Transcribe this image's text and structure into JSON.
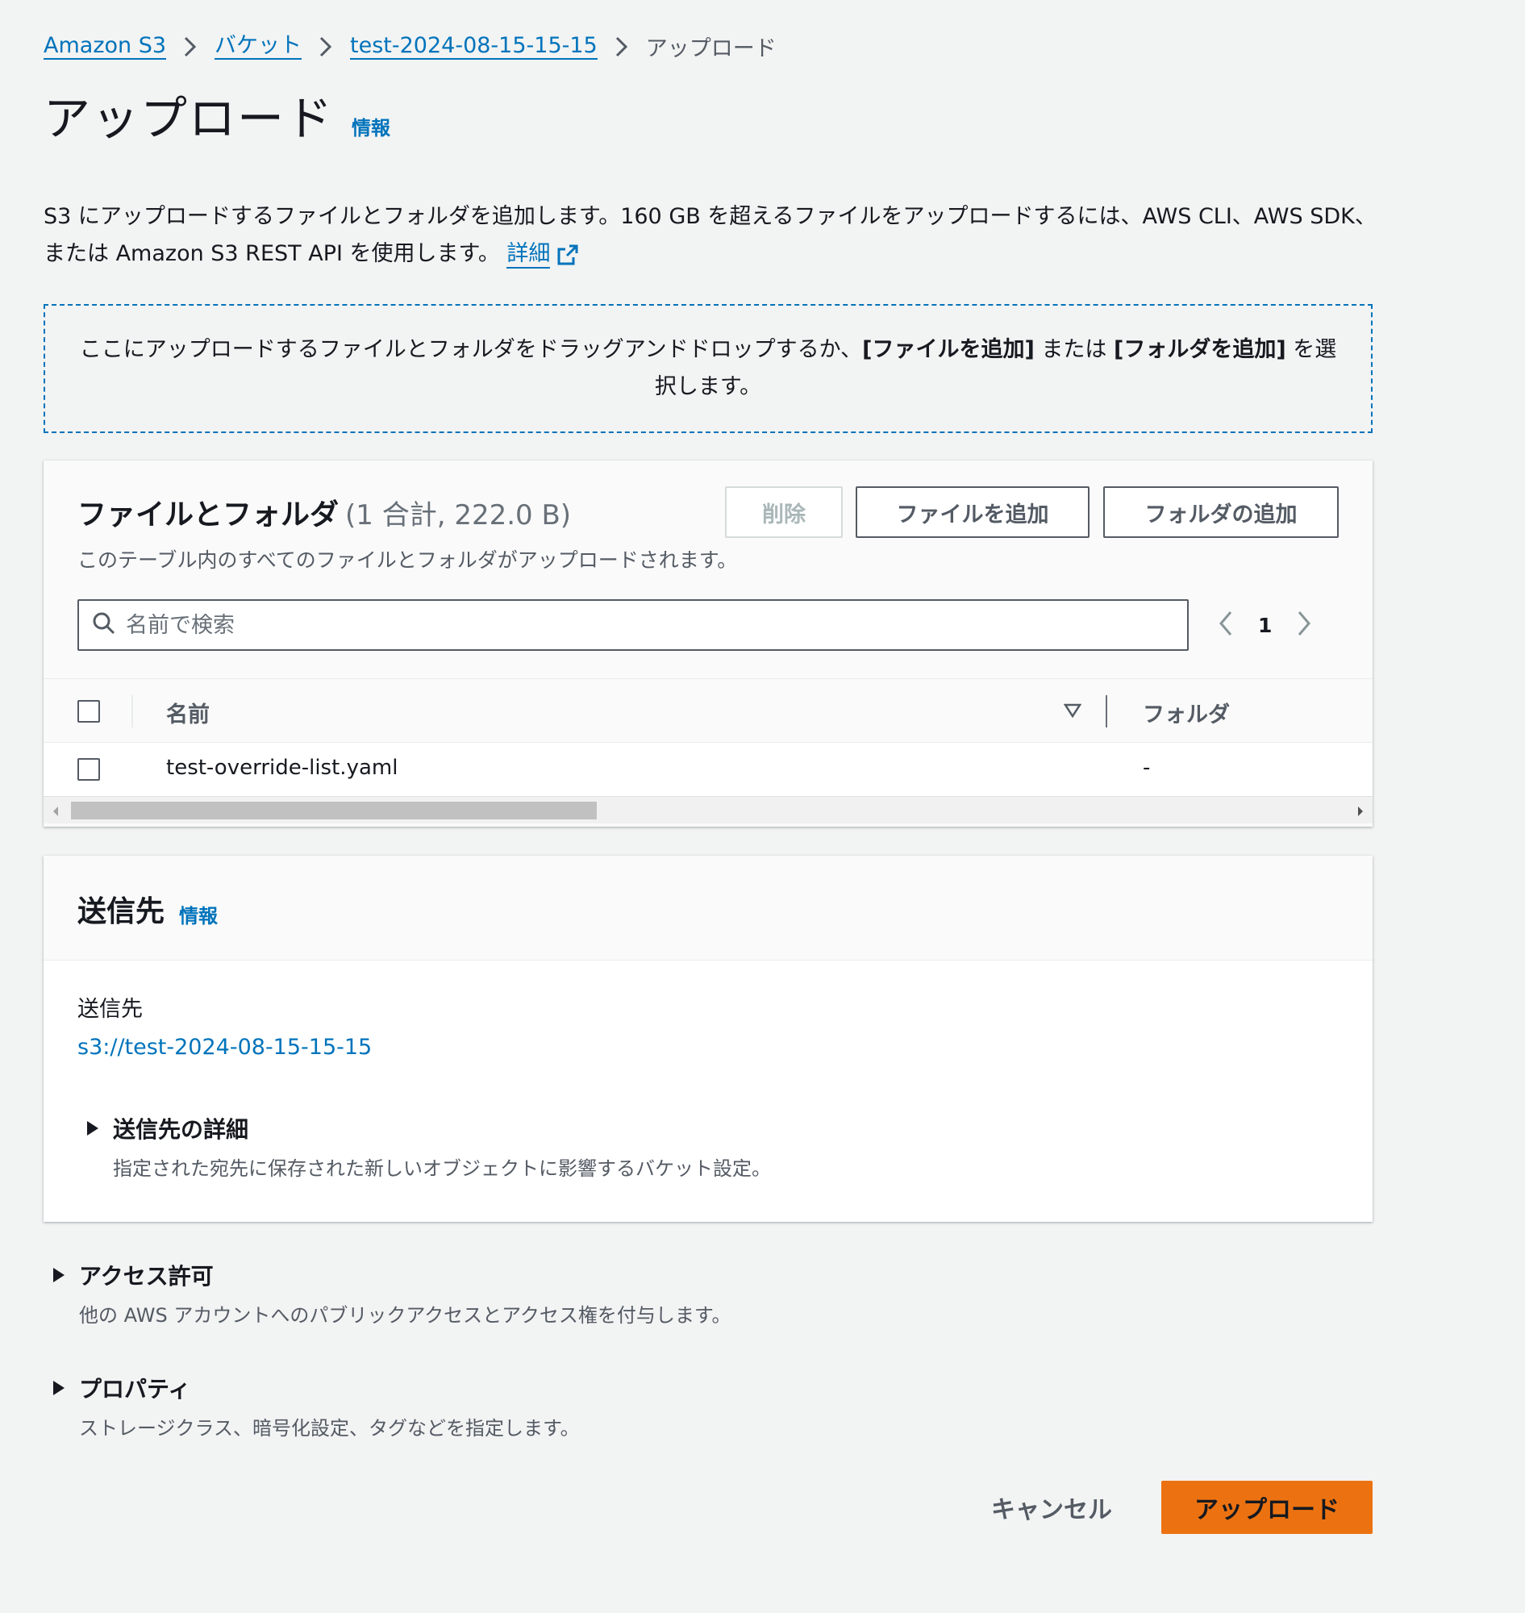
{
  "breadcrumb": {
    "items": [
      "Amazon S3",
      "バケット",
      "test-2024-08-15-15-15"
    ],
    "current": "アップロード"
  },
  "page": {
    "title": "アップロード",
    "info": "情報",
    "description": "S3 にアップロードするファイルとフォルダを追加します。160 GB を超えるファイルをアップロードするには、AWS CLI、AWS SDK、または Amazon S3 REST API を使用します。",
    "details_link": "詳細"
  },
  "dropzone": {
    "text_1": "ここにアップロードするファイルとフォルダをドラッグアンドドロップするか、",
    "bold_1": "[ファイルを追加]",
    "text_2": " または ",
    "bold_2": "[フォルダを追加]",
    "text_3": " を選択します。"
  },
  "files": {
    "title": "ファイルとフォルダ",
    "count": "(1 合計, 222.0 B)",
    "subtitle": "このテーブル内のすべてのファイルとフォルダがアップロードされます。",
    "delete_label": "削除",
    "add_file_label": "ファイルを追加",
    "add_folder_label": "フォルダの追加",
    "search_placeholder": "名前で検索",
    "page_number": "1",
    "columns": [
      "名前",
      "フォルダ"
    ],
    "rows": [
      {
        "name": "test-override-list.yaml",
        "folder": "-"
      }
    ]
  },
  "destination": {
    "title": "送信先",
    "info": "情報",
    "label": "送信先",
    "value": "s3://test-2024-08-15-15-15",
    "details_title": "送信先の詳細",
    "details_sub": "指定された宛先に保存された新しいオブジェクトに影響するバケット設定。"
  },
  "permissions": {
    "title": "アクセス許可",
    "sub": "他の AWS アカウントへのパブリックアクセスとアクセス権を付与します。"
  },
  "properties": {
    "title": "プロパティ",
    "sub": "ストレージクラス、暗号化設定、タグなどを指定します。"
  },
  "footer": {
    "cancel_label": "キャンセル",
    "upload_label": "アップロード"
  },
  "colors": {
    "link": "#0073bb",
    "primary": "#ec7211",
    "background": "#f2f3f3"
  }
}
